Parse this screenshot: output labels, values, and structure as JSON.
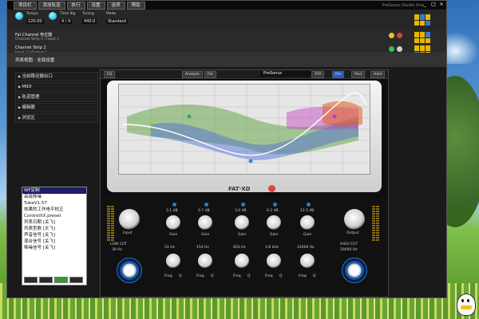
{
  "menubar": {
    "items": [
      "项目栏",
      "添加轨道",
      "执行",
      "设置",
      "选项",
      "帮助"
    ],
    "brand": "PreSonus Studio One"
  },
  "window_buttons": [
    "_",
    "□",
    "×"
  ],
  "transport": {
    "tempo_label": "Tempo",
    "tempo_value": "120.00",
    "timesig_label": "Time Sig",
    "timesig_value": "4 / 4",
    "tuning_label": "Tuning",
    "tuning_value": "440.0",
    "mode_label": "Mode",
    "mode_value": "Standard"
  },
  "track1": {
    "name": "Fat Channel 电位器",
    "sub": "Channel Strip 1 / Input 1"
  },
  "track2": {
    "name": "Channel Strip 2",
    "sub": "Input 2 / Output 1"
  },
  "track3": {
    "label": "列表视图 · 全局设置"
  },
  "leftpanel": {
    "items": [
      "当前路径输出口",
      "MIDI",
      "轨道管理",
      "编辑器",
      "浏览区"
    ]
  },
  "plugin": {
    "preset_label": "EQ",
    "tabs": [
      "Analyze",
      "Fat"
    ],
    "brand": "PreSonus",
    "brand_suffix": "XTA",
    "right_tabs": [
      "Pre",
      "Post",
      "Hold"
    ],
    "logo": "FAT·XD",
    "bands": [
      {
        "gain": "0.0 dB",
        "freq": "30 Hz",
        "label": "LOW CUT"
      },
      {
        "gain": "3.1 dB",
        "freq": "51 Hz",
        "label": "Gain"
      },
      {
        "gain": "0.7 dB",
        "freq": "154 Hz",
        "label": "Gain"
      },
      {
        "gain": "3.0 dB",
        "freq": "853 Hz",
        "label": "Gain"
      },
      {
        "gain": "6.2 dB",
        "freq": "3.8 kHz",
        "label": "Gain"
      },
      {
        "gain": "12.5 dB",
        "freq": "14000 Hz",
        "label": "Gain"
      },
      {
        "gain": "0.0 dB",
        "freq": "20000 Hz",
        "label": "HIGH CUT"
      }
    ],
    "input_label": "Input",
    "output_label": "Output",
    "freq_label": "Freq",
    "q_label": "Q"
  },
  "bottompanel": {
    "items": [
      "WF定制",
      "高级降噪",
      "TubeV1.57",
      "效果的工作电平校正",
      "ControlXX.preset",
      "列表日期 [关飞]",
      "列表型数 [天飞]",
      "声音信号 [关飞]",
      "混合信号 [关飞]",
      "降噪信号 [关飞]"
    ],
    "highlight_index": 0
  }
}
